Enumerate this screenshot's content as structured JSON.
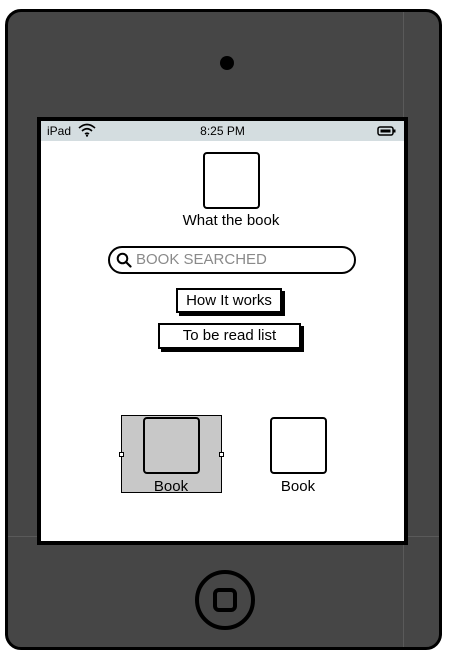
{
  "status_bar": {
    "device": "iPad",
    "time": "8:25 PM",
    "wifi_icon": "wifi-icon",
    "battery_icon": "battery-icon"
  },
  "header": {
    "logo_caption": "What the book"
  },
  "search": {
    "placeholder": "BOOK SEARCHED",
    "icon": "search-icon"
  },
  "buttons": {
    "how_it_works": "How It works",
    "to_be_read_list": "To be read list"
  },
  "books": [
    {
      "label": "Book",
      "selected": true
    },
    {
      "label": "Book",
      "selected": false
    }
  ],
  "colors": {
    "device_body": "#464646",
    "status_bar": "#d4dde0",
    "selection": "#c8c8c8",
    "placeholder_text": "#8a8a8a"
  }
}
